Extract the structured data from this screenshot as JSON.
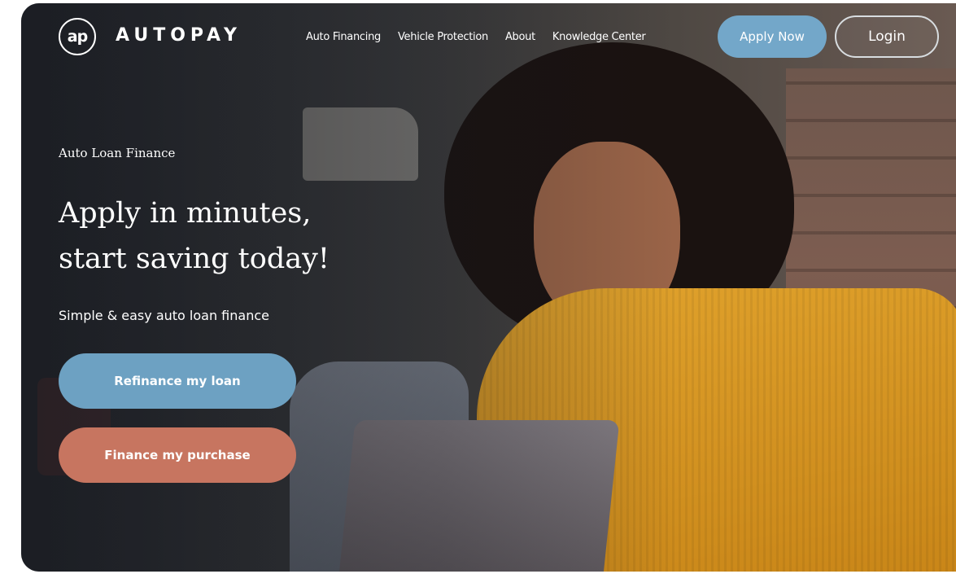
{
  "brand": {
    "logo_mark": "ap",
    "name": "AUTOPAY"
  },
  "nav": {
    "links": [
      "Auto Financing",
      "Vehicle Protection",
      "About",
      "Knowledge Center"
    ],
    "apply_label": "Apply Now",
    "login_label": "Login"
  },
  "hero": {
    "eyebrow": "Auto Loan Finance",
    "headline_line1": "Apply in minutes,",
    "headline_line2": "start saving today!",
    "subhead": "Simple & easy auto loan finance",
    "cta_refinance": "Refinance my loan",
    "cta_purchase": "Finance my purchase"
  },
  "colors": {
    "accent_blue": "#73a7c9",
    "accent_terracotta": "#c77560",
    "sweater_mustard": "#e0a22c"
  }
}
